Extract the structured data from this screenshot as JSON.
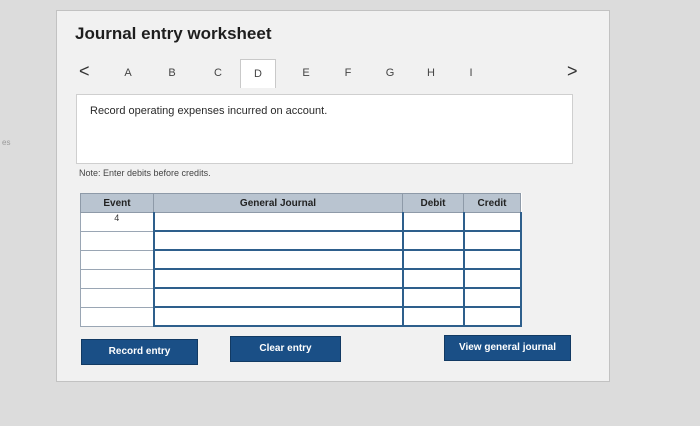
{
  "side_label": "es",
  "title": "Journal entry worksheet",
  "tabs": [
    "A",
    "B",
    "C",
    "D",
    "E",
    "F",
    "G",
    "H",
    "I"
  ],
  "active_tab": "D",
  "prev_arrow": "<",
  "next_arrow": ">",
  "description": "Record operating expenses incurred on account.",
  "note": "Note: Enter debits before credits.",
  "table": {
    "headers": {
      "event": "Event",
      "general_journal": "General Journal",
      "debit": "Debit",
      "credit": "Credit"
    },
    "rows": [
      {
        "event": "4",
        "account": "",
        "debit": "",
        "credit": ""
      },
      {
        "event": "",
        "account": "",
        "debit": "",
        "credit": ""
      },
      {
        "event": "",
        "account": "",
        "debit": "",
        "credit": ""
      },
      {
        "event": "",
        "account": "",
        "debit": "",
        "credit": ""
      },
      {
        "event": "",
        "account": "",
        "debit": "",
        "credit": ""
      },
      {
        "event": "",
        "account": "",
        "debit": "",
        "credit": ""
      }
    ]
  },
  "buttons": {
    "record": "Record entry",
    "clear": "Clear entry",
    "view": "View general journal"
  },
  "colors": {
    "button": "#1a4f86",
    "header": "#b9c4d0",
    "grid": "#2e5f8c"
  }
}
